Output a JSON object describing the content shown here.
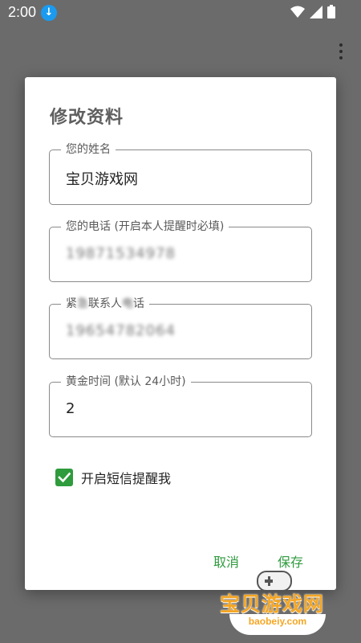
{
  "status_bar": {
    "time": "2:00",
    "download_icon": "download-icon",
    "wifi_icon": "wifi-icon",
    "signal_icon": "signal-icon",
    "battery_icon": "battery-icon"
  },
  "toolbar": {
    "overflow_icon": "more-vert-icon"
  },
  "dialog": {
    "title": "修改资料",
    "fields": [
      {
        "label": "您的姓名",
        "value": "宝贝游戏网"
      },
      {
        "label": "您的电话 (开启本人提醒时必填)",
        "value": "19871534978"
      },
      {
        "label_prefix": "紧",
        "label_blurred": "急",
        "label_mid": "联系人",
        "label_blurred2": "电",
        "label_suffix": "话",
        "value": "19654782064"
      },
      {
        "label": "黄金时间 (默认 24小时)",
        "value": "2"
      }
    ],
    "checkbox": {
      "label": "开启短信提醒我",
      "checked": true
    },
    "buttons": {
      "cancel": "取消",
      "save": "保存"
    }
  },
  "watermark": {
    "text": "宝贝游戏网",
    "url": "baobeiy.com"
  },
  "colors": {
    "accent": "#2f9b3f",
    "scrim": "#6b6b6b",
    "watermark": "#f5a623"
  }
}
